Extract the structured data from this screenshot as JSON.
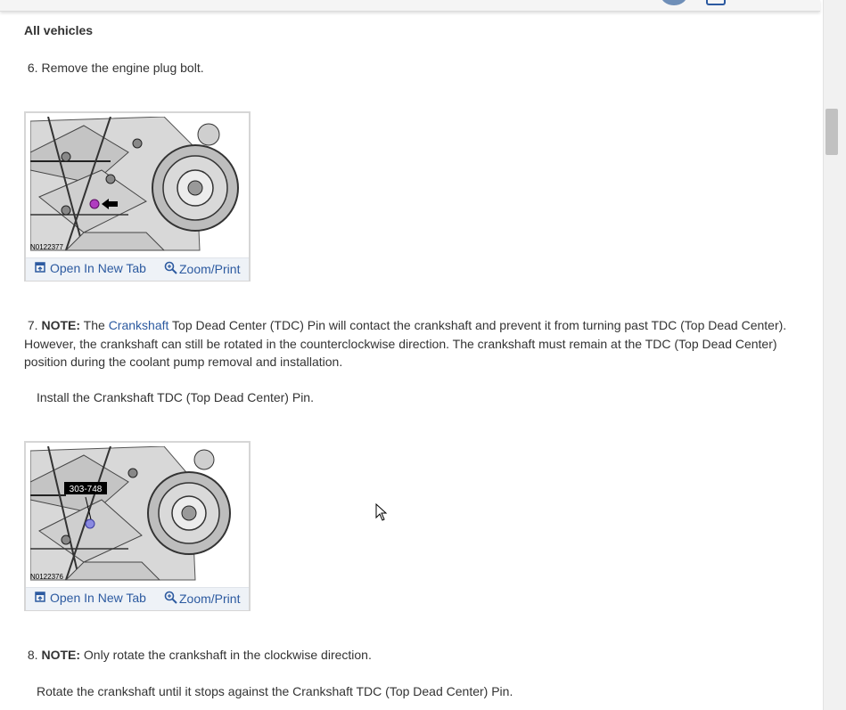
{
  "header": {
    "section": "All vehicles"
  },
  "steps": [
    {
      "number": "6.",
      "text": "Remove the engine plug bolt."
    },
    {
      "number": "7.",
      "note_label": "NOTE:",
      "note_pre": "The",
      "note_link": "Crankshaft",
      "note_line1_rest": "Top Dead Center (TDC) Pin will contact the crankshaft and prevent it from turning past TDC (Top Dead Center).",
      "note_line2": "However, the crankshaft can still be rotated in the counterclockwise direction. The crankshaft must remain at the TDC (Top Dead Center)",
      "note_line3": "position during the coolant pump removal and installation.",
      "instruction": "Install the Crankshaft TDC (Top Dead Center) Pin."
    },
    {
      "number": "8.",
      "note_label": "NOTE:",
      "note_text": "Only rotate the crankshaft in the clockwise direction.",
      "instruction": "Rotate the crankshaft until it stops against the Crankshaft TDC (Top Dead Center) Pin."
    }
  ],
  "figures": [
    {
      "image_id": "N0122377",
      "open_label": "Open In New Tab",
      "zoom_label": "Zoom/Print"
    },
    {
      "image_id": "N0122376",
      "tool_label": "303-748",
      "open_label": "Open In New Tab",
      "zoom_label": "Zoom/Print"
    }
  ],
  "icons": {
    "open": "open-in-new-tab-icon",
    "zoom": "magnifier-icon"
  },
  "colors": {
    "link": "#2c5aa0",
    "text": "#333333",
    "marker_magenta": "#b03cc0",
    "marker_blue": "#8a8ae0"
  }
}
